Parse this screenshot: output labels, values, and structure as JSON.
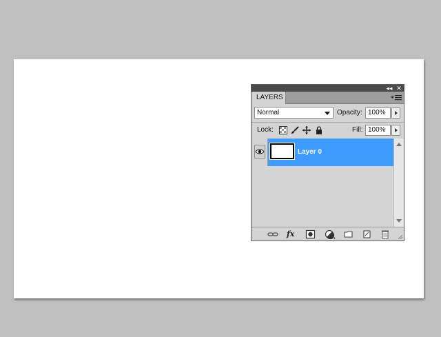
{
  "panel": {
    "title_buttons": {
      "collapse": "◂◂",
      "close": "✕"
    },
    "tab_label": "LAYERS",
    "blend_mode": "Normal",
    "opacity_label": "Opacity:",
    "opacity_value": "100%",
    "lock_label": "Lock:",
    "fill_label": "Fill:",
    "fill_value": "100%",
    "layers": [
      {
        "name": "Layer 0",
        "visible": true,
        "selected": true
      }
    ],
    "bottom_icons": [
      "link-layers-icon",
      "fx-icon",
      "add-mask-icon",
      "adjustment-layer-icon",
      "new-group-icon",
      "new-layer-icon",
      "trash-icon"
    ],
    "fx_text": "fx",
    "selection_color": "#3d9aff"
  }
}
